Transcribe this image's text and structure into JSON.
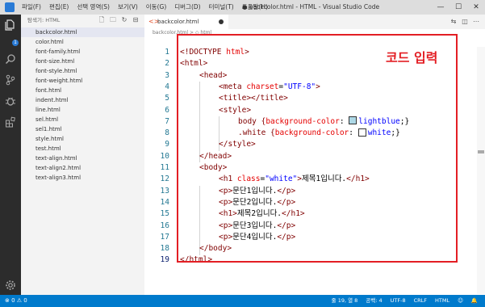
{
  "menu": [
    "파일(F)",
    "편집(E)",
    "선택 영역(S)",
    "보기(V)",
    "이동(G)",
    "디버그(D)",
    "터미널(T)",
    "도움말(H)"
  ],
  "window_title": "● backcolor.html - HTML - Visual Studio Code",
  "window_buttons": {
    "minimize": "—",
    "maximize": "☐",
    "close": "✕"
  },
  "activity": {
    "badge": "1"
  },
  "explorer": {
    "header": "탐색기: HTML",
    "files": [
      "backcolor.html",
      "color.html",
      "font-family.html",
      "font-size.html",
      "font-style.html",
      "font-weight.html",
      "font.html",
      "indent.html",
      "line.html",
      "sel.html",
      "sel1.html",
      "style.html",
      "test.html",
      "text-align.html",
      "text-align2.html",
      "text-align3.html"
    ]
  },
  "tab": {
    "label": "backcolor.html"
  },
  "breadcrumb": "backcolor.html > ◇ html",
  "code": {
    "line_numbers": [
      "1",
      "2",
      "3",
      "4",
      "5",
      "6",
      "7",
      "8",
      "9",
      "10",
      "11",
      "12",
      "13",
      "14",
      "15",
      "16",
      "17",
      "18",
      "19"
    ],
    "l1": {
      "a": "<!DOCTYPE",
      "b": " html",
      "c": ">"
    },
    "l2": "<html>",
    "l3": "<head>",
    "l4": {
      "a": "<meta",
      "b": " charset",
      "c": "=",
      "d": "\"UTF-8\"",
      "e": ">"
    },
    "l5": "<title></title>",
    "l6": "<style>",
    "l7": {
      "a": "body {",
      "b": "background-color",
      "c": ": ",
      "d": "lightblue",
      "e": ";}"
    },
    "l8": {
      "a": ".white {",
      "b": "background-color",
      "c": ": ",
      "d": "white",
      "e": ";}"
    },
    "l9": "</style>",
    "l10": "</head>",
    "l11": "<body>",
    "l12": {
      "a": "<h1",
      "b": " class",
      "c": "=",
      "d": "\"white\"",
      "e": ">",
      "f": "제목1입니다.",
      "g": "</h1>"
    },
    "l13": {
      "a": "<p>",
      "b": "문단1입니다.",
      "c": "</p>"
    },
    "l14": {
      "a": "<p>",
      "b": "문단2입니다.",
      "c": "</p>"
    },
    "l15": {
      "a": "<h1>",
      "b": "제목2입니다.",
      "c": "</h1>"
    },
    "l16": {
      "a": "<p>",
      "b": "문단3입니다.",
      "c": "</p>"
    },
    "l17": {
      "a": "<p>",
      "b": "문단4입니다.",
      "c": "</p>"
    },
    "l18": "</body>",
    "l19": "</html>"
  },
  "colors": {
    "lightblue": "#add8e6",
    "white": "#ffffff",
    "annotation": "#e31e24",
    "status": "#007acc"
  },
  "annotation": "코드 입력",
  "status": {
    "left": "⊗ 0 ⚠ 0",
    "position": "줄 19, 열 8",
    "spaces": "공백: 4",
    "encoding": "UTF-8",
    "eol": "CRLF",
    "language": "HTML"
  }
}
